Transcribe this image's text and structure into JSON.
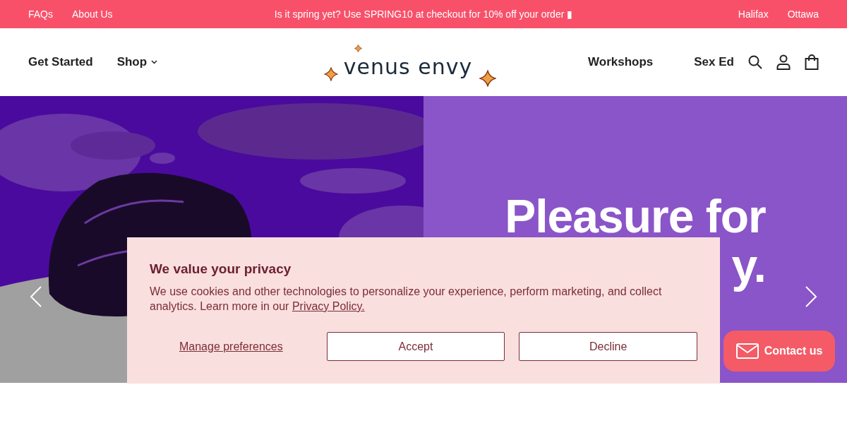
{
  "announcement_bar": {
    "left_links": [
      "FAQs",
      "About Us"
    ],
    "message": "Is it spring yet? Use SPRING10 at checkout for 10% off your order ▮",
    "right_links": [
      "Halifax",
      "Ottawa"
    ]
  },
  "header": {
    "left_nav": [
      {
        "label": "Get Started",
        "dropdown": false
      },
      {
        "label": "Shop",
        "dropdown": true
      }
    ],
    "logo": "venus envy",
    "right_nav": [
      "Workshops",
      "Sex Ed"
    ]
  },
  "hero": {
    "headline_lines": [
      "Pleasure for",
      "y."
    ]
  },
  "cookie_banner": {
    "title": "We value your privacy",
    "text": "We use cookies and other technologies to personalize your experience, perform marketing, and collect analytics. Learn more in our",
    "link": "Privacy Policy.",
    "manage": "Manage preferences",
    "buttons": [
      "Accept",
      "Decline"
    ]
  },
  "contact_button": "Contact us"
}
